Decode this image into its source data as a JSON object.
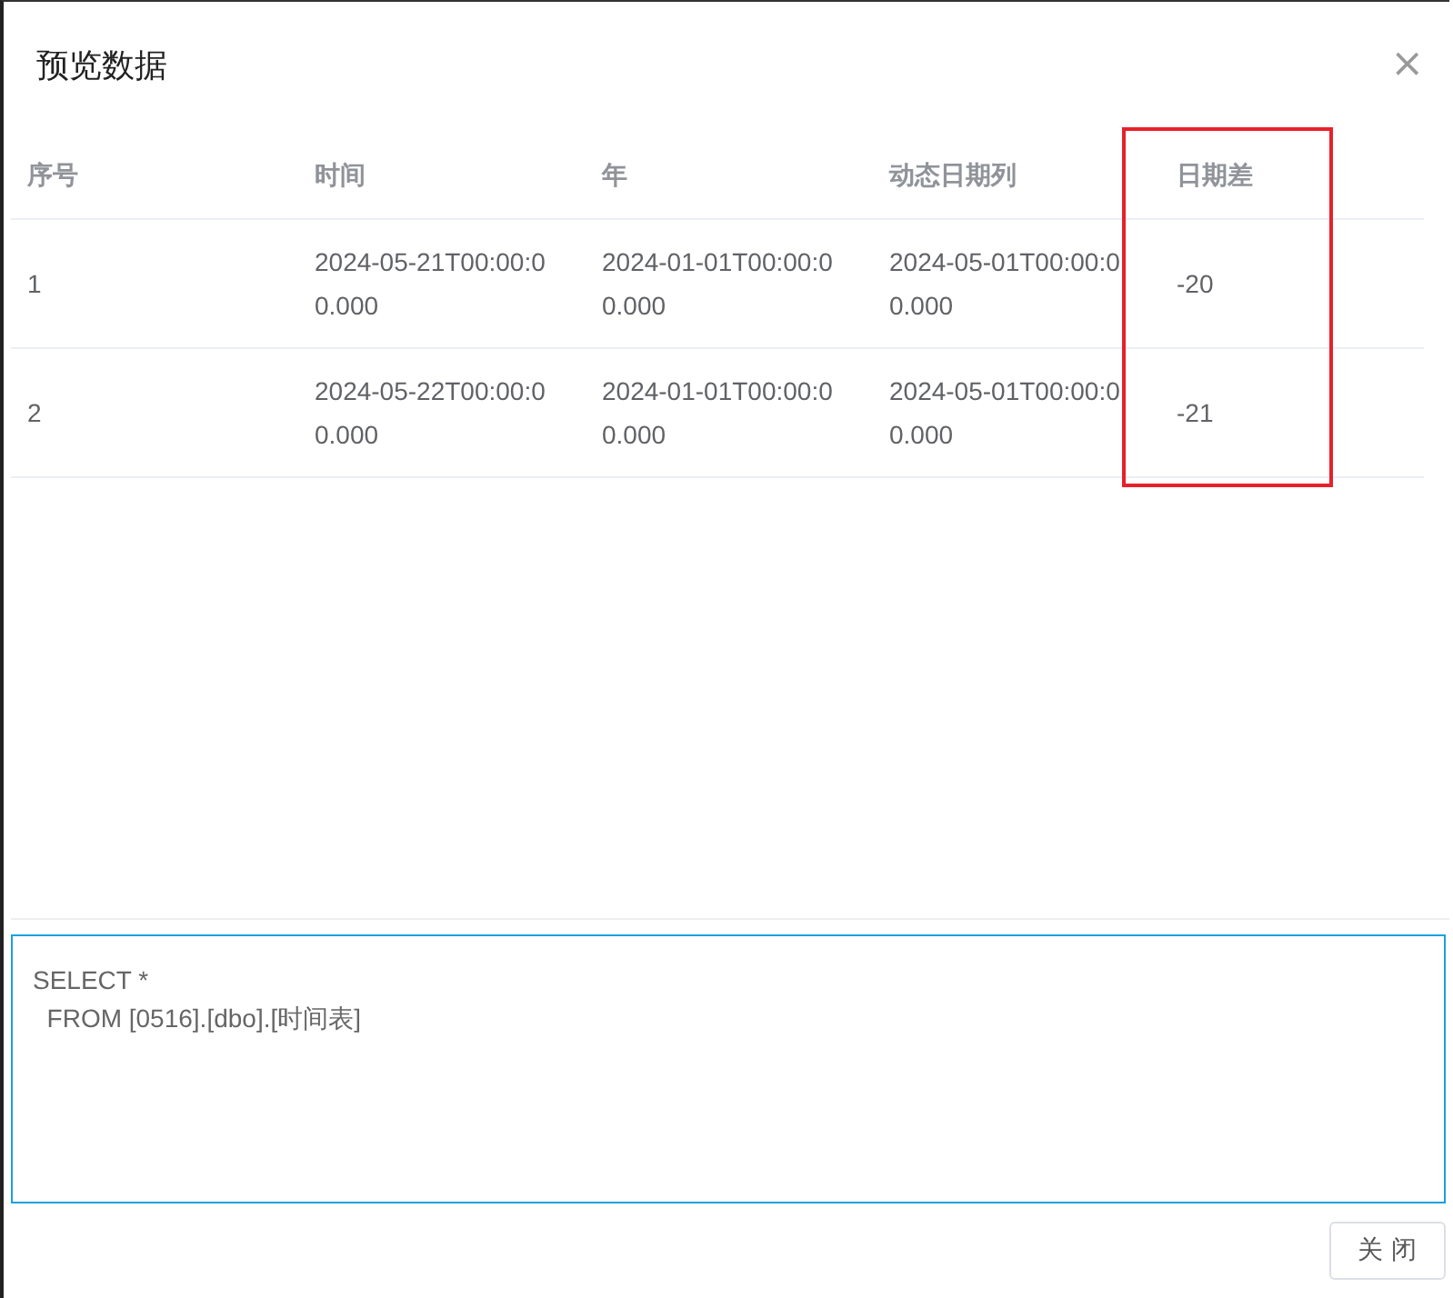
{
  "dialog": {
    "title": "预览数据",
    "close": "×"
  },
  "table": {
    "columns": [
      {
        "label": "序号",
        "highlighted": false
      },
      {
        "label": "时间",
        "highlighted": false
      },
      {
        "label": "年",
        "highlighted": false
      },
      {
        "label": "动态日期列",
        "highlighted": false
      },
      {
        "label": "日期差",
        "highlighted": true
      }
    ],
    "rows": [
      [
        "1",
        "2024-05-21T00:00:00.000",
        "2024-01-01T00:00:00.000",
        "2024-05-01T00:00:00.000",
        "-20"
      ],
      [
        "2",
        "2024-05-22T00:00:00.000",
        "2024-01-01T00:00:00.000",
        "2024-05-01T00:00:00.000",
        "-21"
      ]
    ]
  },
  "sql": [
    "SELECT *",
    "  FROM [0516].[dbo].[时间表]"
  ],
  "buttons": [
    "关 闭"
  ]
}
